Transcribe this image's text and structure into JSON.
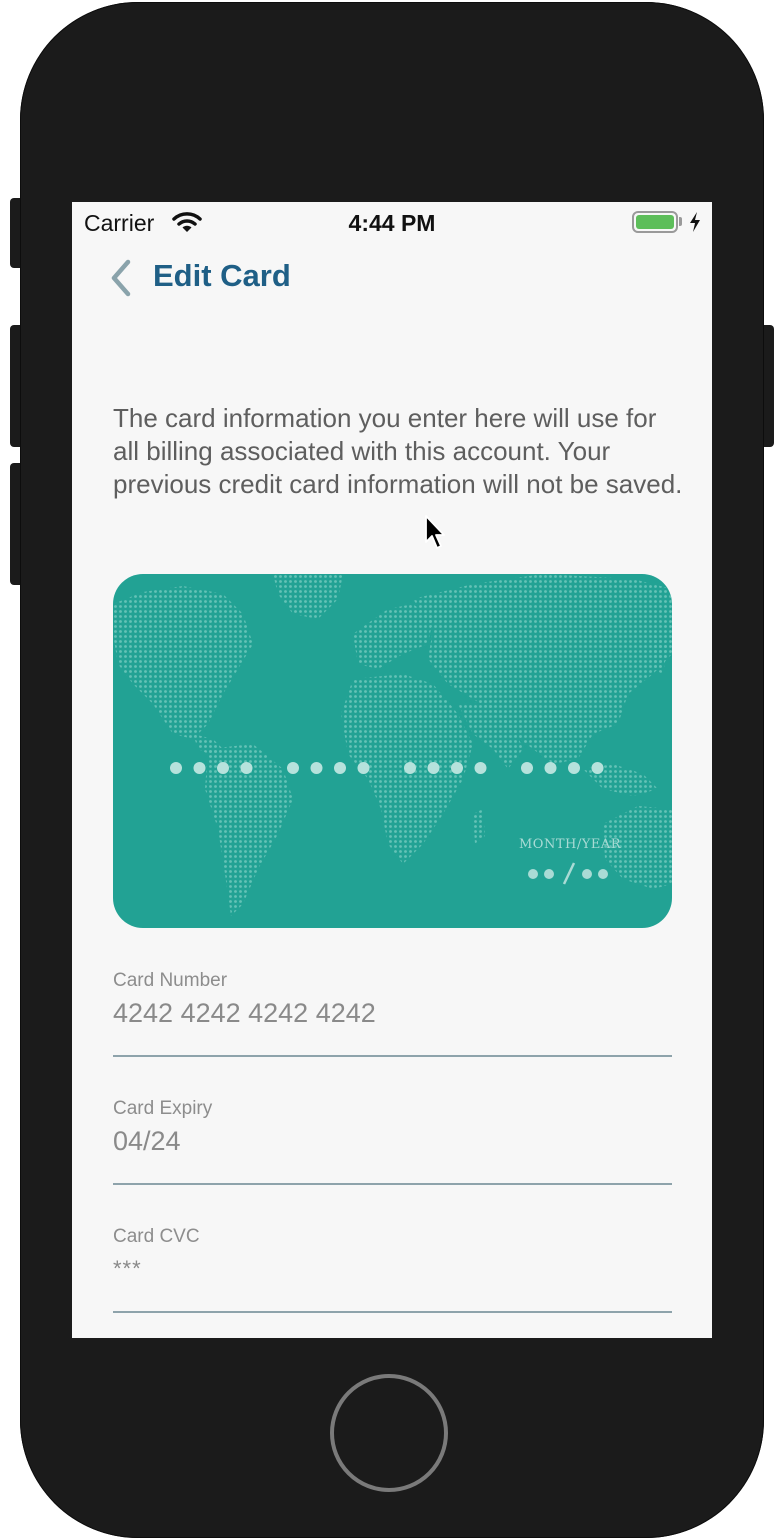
{
  "status_bar": {
    "carrier": "Carrier",
    "time": "4:44 PM",
    "battery_level": 1.0,
    "battery_color": "#5dbe5a",
    "icons": [
      "wifi-icon",
      "battery-icon",
      "charging-bolt-icon"
    ]
  },
  "nav": {
    "back_icon": "chevron-left-icon",
    "title": "Edit Card"
  },
  "intro": "The card information you enter here will use for all billing associated with this account. Your previous credit card information will not be saved.",
  "card": {
    "color": "#22a294",
    "expiry_label": "MONTH/YEAR",
    "number_dot_groups": 4,
    "dots_per_group": 4
  },
  "fields": {
    "card_number": {
      "label": "Card Number",
      "value": "4242 4242 4242 4242"
    },
    "card_expiry": {
      "label": "Card Expiry",
      "value": "04/24"
    },
    "card_cvc": {
      "label": "Card CVC",
      "value": "***"
    }
  },
  "colors": {
    "title_blue": "#1f5f86",
    "back_chevron": "#8aa3ab",
    "underline": "#8ea3ab"
  }
}
